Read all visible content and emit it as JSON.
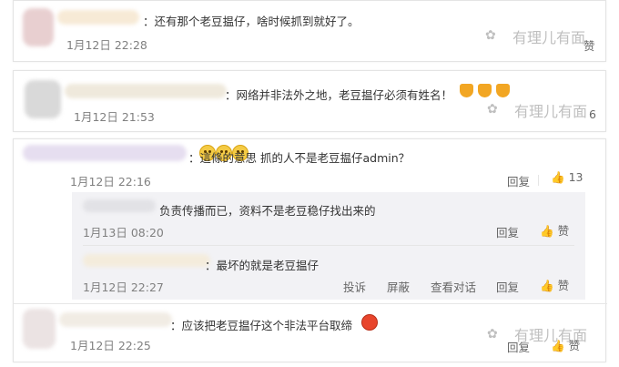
{
  "comments": [
    {
      "text": "：还有那个老豆揾仔，啥时候抓到就好了。",
      "time": "1月12日 22:28",
      "watermark": "有理儿有面",
      "like_fragment": "赞"
    },
    {
      "text": "：网络并非法外之地，老豆揾仔必须有姓名！",
      "time": "1月12日 21:53",
      "watermark": "有理儿有面",
      "like_fragment": "6"
    },
    {
      "text": "：這條的意思 抓的人不是老豆揾仔admin？",
      "time": "1月12日 22:16",
      "reply_label": "回复",
      "like_count": "13"
    },
    {
      "text": "：应该把老豆揾仔这个非法平台取缔",
      "time": "1月12日 22:25",
      "reply_label": "回复",
      "like_label": "赞",
      "watermark": "有理儿有面"
    }
  ],
  "replies": [
    {
      "text": "负责传播而已，资料不是老豆稳仔找出来的",
      "time": "1月13日 08:20",
      "reply_label": "回复",
      "like_label": "赞"
    },
    {
      "text": "：最坏的就是老豆揾仔",
      "time": "1月12日 22:27",
      "report_label": "投诉",
      "block_label": "屏蔽",
      "view_label": "查看对话",
      "reply_label": "回复",
      "like_label": "赞"
    }
  ],
  "colors": {
    "emoji_yellow": "#f4cb45",
    "hand_orange": "#f2a623",
    "watermark": "#bfbfbf"
  },
  "icons": [
    "thumb-up-icon",
    "wechat-icon",
    "sad-face-icon",
    "hand-pointing-down-icon",
    "angry-face-icon"
  ]
}
